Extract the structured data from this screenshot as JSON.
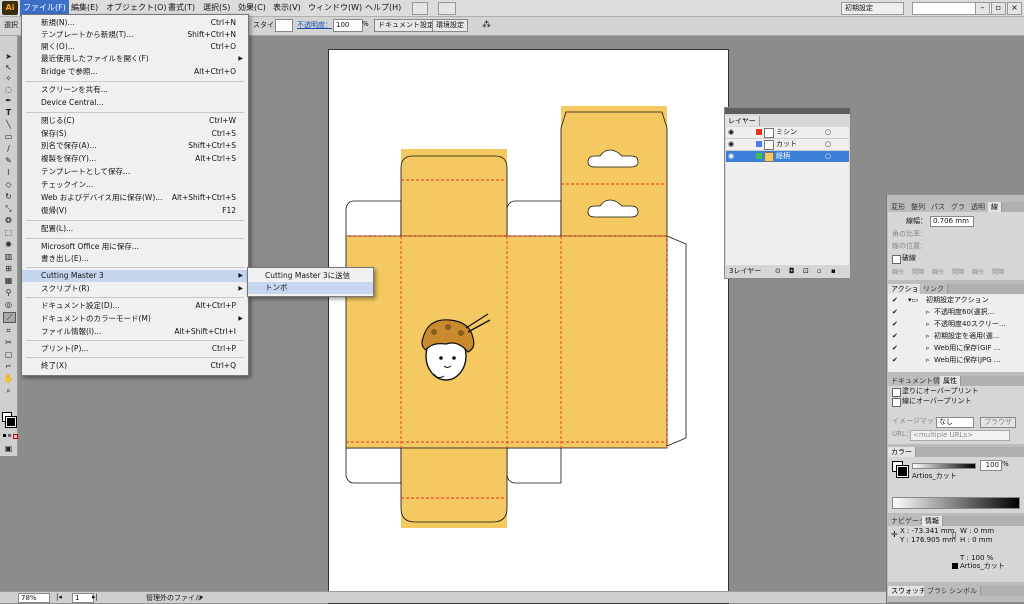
{
  "app": {
    "logo": "Ai",
    "workspace": "初期設定",
    "menus": [
      "ファイル(F)",
      "編集(E)",
      "オブジェクト(O)",
      "書式(T)",
      "選択(S)",
      "効果(C)",
      "表示(V)",
      "ウィンドウ(W)",
      "ヘルプ(H)"
    ]
  },
  "control_bar": {
    "selection_label": "選択",
    "style_label": "スタイル：",
    "opacity_label": "不透明度：",
    "opacity_value": "100",
    "opacity_unit": "%",
    "doc_settings_button": "ドキュメント設定",
    "prefs_button": "環境設定"
  },
  "file_menu": {
    "items": [
      {
        "label": "新規(N)...",
        "shortcut": "Ctrl+N"
      },
      {
        "label": "テンプレートから新規(T)...",
        "shortcut": "Shift+Ctrl+N"
      },
      {
        "label": "開く(O)...",
        "shortcut": "Ctrl+O"
      },
      {
        "label": "最近使用したファイルを開く(F)",
        "shortcut": "",
        "arrow": "▶"
      },
      {
        "label": "Bridge で参照...",
        "shortcut": "Alt+Ctrl+O"
      },
      {
        "label": "スクリーンを共有...",
        "shortcut": ""
      },
      {
        "label": "Device Central...",
        "shortcut": ""
      },
      {
        "label": "閉じる(C)",
        "shortcut": "Ctrl+W"
      },
      {
        "label": "保存(S)",
        "shortcut": "Ctrl+S"
      },
      {
        "label": "別名で保存(A)...",
        "shortcut": "Shift+Ctrl+S"
      },
      {
        "label": "複製を保存(Y)...",
        "shortcut": "Alt+Ctrl+S"
      },
      {
        "label": "テンプレートとして保存...",
        "shortcut": ""
      },
      {
        "label": "チェックイン...",
        "shortcut": ""
      },
      {
        "label": "Web およびデバイス用に保存(W)...",
        "shortcut": "Alt+Shift+Ctrl+S"
      },
      {
        "label": "復帰(V)",
        "shortcut": "F12"
      },
      {
        "label": "配置(L)...",
        "shortcut": ""
      },
      {
        "label": "Microsoft Office 用に保存...",
        "shortcut": ""
      },
      {
        "label": "書き出し(E)...",
        "shortcut": ""
      },
      {
        "label": "Cutting Master 3",
        "shortcut": "",
        "arrow": "▶"
      },
      {
        "label": "スクリプト(R)",
        "shortcut": "",
        "arrow": "▶"
      },
      {
        "label": "ドキュメント設定(D)...",
        "shortcut": "Alt+Ctrl+P"
      },
      {
        "label": "ドキュメントのカラーモード(M)",
        "shortcut": "",
        "arrow": "▶"
      },
      {
        "label": "ファイル情報(I)...",
        "shortcut": "Alt+Shift+Ctrl+I"
      },
      {
        "label": "プリント(P)...",
        "shortcut": "Ctrl+P"
      },
      {
        "label": "終了(X)",
        "shortcut": "Ctrl+Q"
      }
    ]
  },
  "submenu": {
    "items": [
      "Cutting Master 3に送信",
      "トンボ"
    ]
  },
  "layers_panel": {
    "title": "レイヤー",
    "layers": [
      "ミシン",
      "カット",
      "総柄"
    ],
    "footer": "3レイヤー"
  },
  "stroke_panel": {
    "tabs": [
      "変形",
      "整列",
      "パス",
      "グラ",
      "透明",
      "線"
    ],
    "weight_label": "線幅：",
    "weight_value": "0.706 mm",
    "miter_label": "角の比率：",
    "align_label": "線の位置：",
    "dash_label": "破線",
    "dash_cells": [
      "線分",
      "間隔",
      "線分",
      "間隔",
      "線分",
      "間隔"
    ]
  },
  "actions_panel": {
    "tabs": [
      "アクション",
      "リンク"
    ],
    "items": [
      "初期設定アクション",
      "不透明度60(選択...",
      "不透明度40スクリー...",
      "初期設定を適用(選...",
      "Web用に保存(GIF ...",
      "Web用に保存(JPG ..."
    ]
  },
  "doc_info_panel": {
    "tabs": [
      "ドキュメント情報",
      "属性"
    ],
    "overprint_fill": "塗りにオーバープリント",
    "overprint_stroke": "線にオーバープリント",
    "image_map_label": "イメージマップ：",
    "image_map_value": "なし",
    "browser_button": "ブラウザ",
    "url_label": "URL：",
    "url_value": "<multiple URLs>"
  },
  "color_panel": {
    "tab": "カラー",
    "value": "100",
    "unit": "%",
    "swatch_name": "Artios_カット"
  },
  "info_panel": {
    "tabs": [
      "ナビゲータ",
      "情報"
    ],
    "x": "-73.341 mm",
    "y": "176.905 mm",
    "w": "0 mm",
    "h": "0 mm",
    "t": "100 %",
    "swatch": "Artios_カット"
  },
  "swatch_panel": {
    "tabs": [
      "スウォッチ",
      "ブラシ",
      "シンボル"
    ]
  },
  "status_bar": {
    "zoom": "78%",
    "page": "1",
    "state": "管理外のファイル"
  },
  "colors": {
    "box_fill": "#f5c962",
    "die_line": "#111111",
    "perforation": "#e8311f",
    "menu_highlight": "#c5d6ee",
    "layer_selected": "#3c7fd8"
  }
}
